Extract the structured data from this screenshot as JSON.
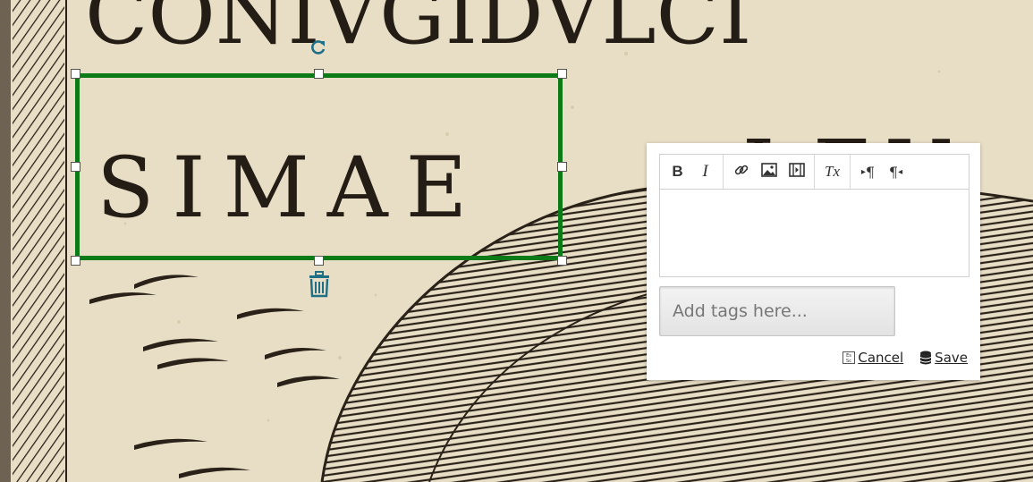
{
  "canvas": {
    "inscription_top": "CONIVGIDVLCI",
    "inscription_selected": "SIMAE",
    "inscription_right": "LEV"
  },
  "selection": {
    "border_color": "#0c7a16",
    "rotate_icon": "rotate-icon",
    "delete_icon": "trash-icon"
  },
  "editor": {
    "toolbar": [
      {
        "name": "bold-button",
        "label": "B"
      },
      {
        "name": "italic-button",
        "label": "I"
      },
      {
        "name": "link-button",
        "icon": "link-icon"
      },
      {
        "name": "image-button",
        "icon": "image-icon"
      },
      {
        "name": "video-button",
        "icon": "film-icon"
      },
      {
        "name": "remove-format-button",
        "label": "Tx"
      },
      {
        "name": "ltr-button",
        "label": "¶"
      },
      {
        "name": "rtl-button",
        "label": "¶"
      }
    ],
    "body_text": ""
  },
  "tags": {
    "placeholder": "Add tags here...",
    "value": ""
  },
  "actions": {
    "cancel_label": "Cancel",
    "save_label": "Save",
    "cancel_icon": "keyboard-esc-icon",
    "save_icon": "database-icon"
  }
}
